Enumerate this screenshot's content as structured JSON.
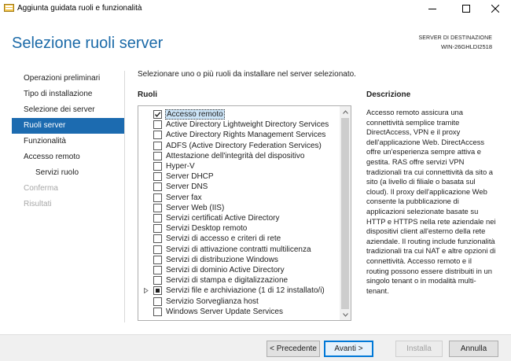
{
  "window": {
    "title": "Aggiunta guidata ruoli e funzionalità",
    "icon": "server-manager-icon"
  },
  "header": {
    "page_title": "Selezione ruoli server",
    "destination_label": "SERVER DI DESTINAZIONE",
    "destination_server": "WIN-26GHLDI2518"
  },
  "nav": {
    "items": [
      {
        "label": "Operazioni preliminari",
        "state": "normal"
      },
      {
        "label": "Tipo di installazione",
        "state": "normal"
      },
      {
        "label": "Selezione dei server",
        "state": "normal"
      },
      {
        "label": "Ruoli server",
        "state": "active"
      },
      {
        "label": "Funzionalità",
        "state": "normal"
      },
      {
        "label": "Accesso remoto",
        "state": "normal"
      },
      {
        "label": "Servizi ruolo",
        "state": "normal"
      },
      {
        "label": "Conferma",
        "state": "disabled"
      },
      {
        "label": "Risultati",
        "state": "disabled"
      }
    ]
  },
  "main": {
    "instructions": "Selezionare uno o più ruoli da installare nel server selezionato.",
    "roles_heading": "Ruoli",
    "description_heading": "Descrizione",
    "roles": [
      {
        "label": "Accesso remoto",
        "checked": "checked",
        "selected": true
      },
      {
        "label": "Active Directory Lightweight Directory Services",
        "checked": "unchecked"
      },
      {
        "label": "Active Directory Rights Management Services",
        "checked": "unchecked"
      },
      {
        "label": "ADFS (Active Directory Federation Services)",
        "checked": "unchecked"
      },
      {
        "label": "Attestazione dell'integrità del dispositivo",
        "checked": "unchecked"
      },
      {
        "label": "Hyper-V",
        "checked": "unchecked"
      },
      {
        "label": "Server DHCP",
        "checked": "unchecked"
      },
      {
        "label": "Server DNS",
        "checked": "unchecked"
      },
      {
        "label": "Server fax",
        "checked": "unchecked"
      },
      {
        "label": "Server Web (IIS)",
        "checked": "unchecked"
      },
      {
        "label": "Servizi certificati Active Directory",
        "checked": "unchecked"
      },
      {
        "label": "Servizi Desktop remoto",
        "checked": "unchecked"
      },
      {
        "label": "Servizi di accesso e criteri di rete",
        "checked": "unchecked"
      },
      {
        "label": "Servizi di attivazione contratti multilicenza",
        "checked": "unchecked"
      },
      {
        "label": "Servizi di distribuzione Windows",
        "checked": "unchecked"
      },
      {
        "label": "Servizi di dominio Active Directory",
        "checked": "unchecked"
      },
      {
        "label": "Servizi di stampa e digitalizzazione",
        "checked": "unchecked"
      },
      {
        "label": "Servizi file e archiviazione (1 di 12 installato/i)",
        "checked": "partial",
        "expandable": true
      },
      {
        "label": "Servizio Sorveglianza host",
        "checked": "unchecked"
      },
      {
        "label": "Windows Server Update Services",
        "checked": "unchecked"
      }
    ],
    "description": "Accesso remoto assicura una connettività semplice tramite DirectAccess, VPN e il proxy dell'applicazione Web. DirectAccess offre un'esperienza sempre attiva e gestita. RAS offre servizi VPN tradizionali tra cui connettività da sito a sito (a livello di filiale o basata sul cloud). Il proxy dell'applicazione Web consente la pubblicazione di applicazioni selezionate basate su HTTP e HTTPS nella rete aziendale nei dispositivi client all'esterno della rete aziendale. Il routing include funzionalità tradizionali tra cui NAT e altre opzioni di connettività. Accesso remoto e il routing possono essere distribuiti in un singolo tenant o in modalità multi-tenant."
  },
  "footer": {
    "previous_label": "< Precedente",
    "next_label": "Avanti >",
    "install_label": "Installa",
    "cancel_label": "Annulla"
  },
  "colors": {
    "accent": "#1c6bb0",
    "title_blue": "#1b6aa8",
    "selection": "#cce4f7"
  }
}
